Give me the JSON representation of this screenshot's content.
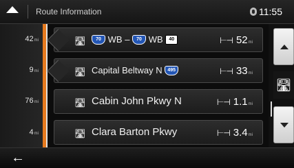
{
  "header": {
    "title": "Route Information",
    "time": "11:55",
    "icons": {
      "menu": "up-arrow-icon",
      "gps": "gps-status-icon"
    }
  },
  "left_column": {
    "distances": [
      {
        "value": "42",
        "unit": "mi"
      },
      {
        "value": "9",
        "unit": "mi"
      },
      {
        "value": "76",
        "unit": "mi"
      },
      {
        "value": "4",
        "unit": "mi"
      }
    ]
  },
  "rows": [
    {
      "road_icon": "road-icon",
      "parts": {
        "shield1": "70",
        "wb1": "WB",
        "dash": "–",
        "shield2": "70",
        "wb2": "WB",
        "shield3": "40"
      },
      "distance": "52",
      "unit": "mi"
    },
    {
      "road_icon": "road-icon",
      "name": "Capital Beltway N",
      "shield": "495",
      "distance": "33",
      "unit": "mi"
    },
    {
      "road_icon": "road-icon",
      "name": "Cabin John Pkwy N",
      "distance": "1.1",
      "unit": "mi"
    },
    {
      "road_icon": "road-icon",
      "name": "Clara Barton Pkwy",
      "distance": "3.4",
      "unit": "mi"
    }
  ],
  "right_panel": {
    "scroll_up_icon": "scroll-up-icon",
    "road_view_icon": "road-view-icon",
    "scroll_down_icon": "scroll-down-icon"
  },
  "footer": {
    "back_icon": "back-arrow-icon"
  },
  "colors": {
    "accent": "#e67a1e",
    "shield_blue": "#2356b5"
  }
}
